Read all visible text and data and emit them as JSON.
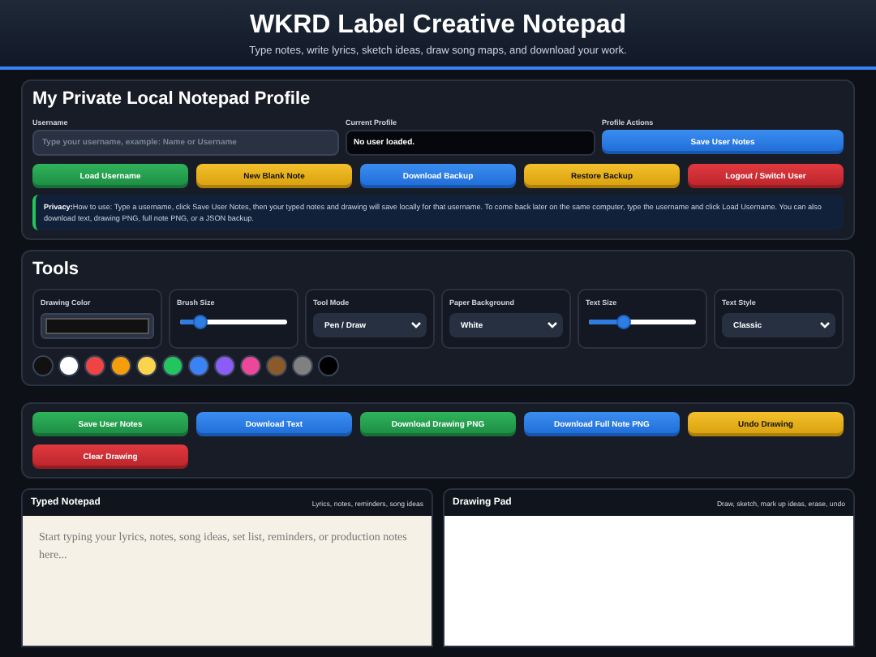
{
  "header": {
    "title": "WKRD Label Creative Notepad",
    "subtitle": "Type notes, write lyrics, sketch ideas, draw song maps, and download your work."
  },
  "profile": {
    "title": "My Private Local Notepad Profile",
    "username": {
      "label": "Username",
      "placeholder": "Type your username, example: Name or Username"
    },
    "current": {
      "label": "Current Profile",
      "value": "No user loaded."
    },
    "actions_label": "Profile Actions",
    "save_button": {
      "label": "Save User Notes",
      "kind": "primary"
    },
    "buttons": [
      {
        "label": "Load Username",
        "kind": "success"
      },
      {
        "label": "New Blank Note",
        "kind": "warning"
      },
      {
        "label": "Download Backup",
        "kind": "primary"
      },
      {
        "label": "Restore Backup",
        "kind": "warning"
      },
      {
        "label": "Logout / Switch User",
        "kind": "danger"
      }
    ],
    "privacy": {
      "lead": "Privacy:",
      "text": "How to use: Type a username, click Save User Notes, then your typed notes and drawing will save locally for that username. To come back later on the same computer, type the username and click Load Username. You can also download text, drawing PNG, full note PNG, or a JSON backup."
    }
  },
  "tools": {
    "title": "Tools",
    "controls": [
      {
        "kind": "color",
        "label": "Drawing Color",
        "color": "#111111"
      },
      {
        "kind": "slider",
        "label": "Brush Size",
        "level": 0.2
      },
      {
        "kind": "select",
        "label": "Tool Mode",
        "value": "Pen / Draw"
      },
      {
        "kind": "select",
        "label": "Paper Background",
        "value": "White"
      },
      {
        "kind": "slider",
        "label": "Text Size",
        "level": 0.33
      },
      {
        "kind": "select",
        "label": "Text Style",
        "value": "Classic"
      }
    ],
    "swatches": [
      {
        "color": "#111111"
      },
      {
        "color": "#ffffff"
      },
      {
        "color": "#ef4444"
      },
      {
        "color": "#f59e0b"
      },
      {
        "color": "#fcd34d"
      },
      {
        "color": "#22c55e"
      },
      {
        "color": "#3b82f6"
      },
      {
        "color": "#8b5cf6"
      },
      {
        "color": "#ec4899"
      },
      {
        "color": "#8b5a2b"
      },
      {
        "color": "#808080"
      },
      {
        "color": "#000000"
      }
    ]
  },
  "actions": [
    {
      "label": "Save User Notes",
      "kind": "success"
    },
    {
      "label": "Download Text",
      "kind": "primary"
    },
    {
      "label": "Download Drawing PNG",
      "kind": "success"
    },
    {
      "label": "Download Full Note PNG",
      "kind": "primary"
    },
    {
      "label": "Undo Drawing",
      "kind": "warning"
    },
    {
      "label": "Clear Drawing",
      "kind": "danger"
    }
  ],
  "notepad": {
    "title": "Typed Notepad",
    "hint": "Lyrics, notes, reminders, song ideas",
    "placeholder": "Start typing your lyrics, notes, song ideas, set list, reminders, or production notes here..."
  },
  "drawing_pad": {
    "title": "Drawing Pad",
    "hint": "Draw, sketch, mark up ideas, erase, undo"
  }
}
